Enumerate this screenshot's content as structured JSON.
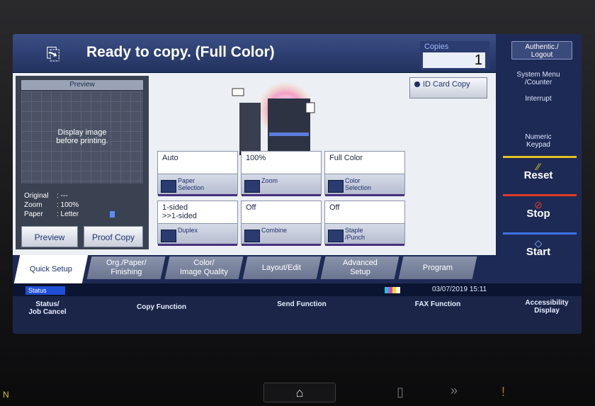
{
  "header": {
    "title": "Ready to copy. (Full Color)",
    "copies_label": "Copies",
    "copies_value": "1"
  },
  "right_panel": {
    "auth": "Authentic./\nLogout",
    "system_menu": "System Menu\n/Counter",
    "interrupt": "Interrupt",
    "numeric_keypad": "Numeric\nKeypad",
    "reset": "Reset",
    "stop": "Stop",
    "start": "Start",
    "reset_color": "#e0c020",
    "stop_color": "#e03a2a",
    "start_color": "#3d73e8"
  },
  "preview": {
    "title": "Preview",
    "message": "Display image\nbefore printing.",
    "info": [
      {
        "key": "Original",
        "value": ": ---"
      },
      {
        "key": "Zoom",
        "value": ": 100%"
      },
      {
        "key": "Paper",
        "value": ": Letter"
      }
    ],
    "preview_button": "Preview",
    "proof_button": "Proof Copy"
  },
  "id_card": "ID Card Copy",
  "tiles": [
    {
      "value": "Auto",
      "label": "Paper\nSelection"
    },
    {
      "value": "100%",
      "label": "Zoom"
    },
    {
      "value": "Full Color",
      "label": "Color\nSelection"
    },
    {
      "value": "1-sided\n>>1-sided",
      "label": "Duplex"
    },
    {
      "value": "Off",
      "label": "Combine"
    },
    {
      "value": "Off",
      "label": "Staple\n/Punch"
    }
  ],
  "tabs": [
    "Quick Setup",
    "Org./Paper/\nFinishing",
    "Color/\nImage Quality",
    "Layout/Edit",
    "Advanced\nSetup",
    "Program"
  ],
  "status": {
    "tag": "Status",
    "datetime": "03/07/2019  15:11"
  },
  "bottom_nav": {
    "status_job": "Status/\nJob Cancel",
    "copy": "Copy Function",
    "send": "Send Function",
    "fax": "FAX Function",
    "accessibility": "Accessibility\nDisplay"
  }
}
